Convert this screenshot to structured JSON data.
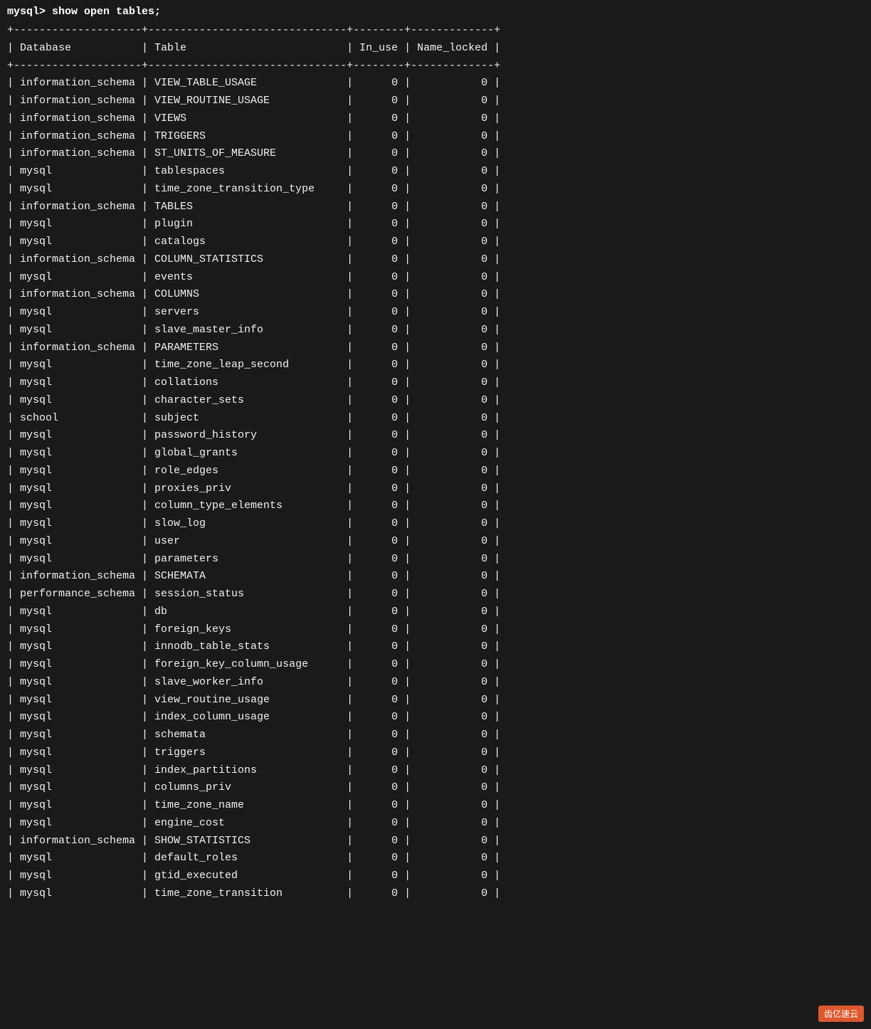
{
  "terminal": {
    "command": "mysql> show open tables;",
    "separator_top": "+--------------------+-------------------------------+--------+-------------+",
    "header": "| Database           | Table                         | In_use | Name_locked |",
    "separator_mid": "+--------------------+-------------------------------+--------+-------------+",
    "rows": [
      {
        "db": "information_schema",
        "table": "VIEW_TABLE_USAGE",
        "inuse": "0",
        "namelocked": "0"
      },
      {
        "db": "information_schema",
        "table": "VIEW_ROUTINE_USAGE",
        "inuse": "0",
        "namelocked": "0"
      },
      {
        "db": "information_schema",
        "table": "VIEWS",
        "inuse": "0",
        "namelocked": "0"
      },
      {
        "db": "information_schema",
        "table": "TRIGGERS",
        "inuse": "0",
        "namelocked": "0"
      },
      {
        "db": "information_schema",
        "table": "ST_UNITS_OF_MEASURE",
        "inuse": "0",
        "namelocked": "0"
      },
      {
        "db": "mysql",
        "table": "tablespaces",
        "inuse": "0",
        "namelocked": "0"
      },
      {
        "db": "mysql",
        "table": "time_zone_transition_type",
        "inuse": "0",
        "namelocked": "0"
      },
      {
        "db": "information_schema",
        "table": "TABLES",
        "inuse": "0",
        "namelocked": "0"
      },
      {
        "db": "mysql",
        "table": "plugin",
        "inuse": "0",
        "namelocked": "0"
      },
      {
        "db": "mysql",
        "table": "catalogs",
        "inuse": "0",
        "namelocked": "0"
      },
      {
        "db": "information_schema",
        "table": "COLUMN_STATISTICS",
        "inuse": "0",
        "namelocked": "0"
      },
      {
        "db": "mysql",
        "table": "events",
        "inuse": "0",
        "namelocked": "0"
      },
      {
        "db": "information_schema",
        "table": "COLUMNS",
        "inuse": "0",
        "namelocked": "0"
      },
      {
        "db": "mysql",
        "table": "servers",
        "inuse": "0",
        "namelocked": "0"
      },
      {
        "db": "mysql",
        "table": "slave_master_info",
        "inuse": "0",
        "namelocked": "0"
      },
      {
        "db": "information_schema",
        "table": "PARAMETERS",
        "inuse": "0",
        "namelocked": "0"
      },
      {
        "db": "mysql",
        "table": "time_zone_leap_second",
        "inuse": "0",
        "namelocked": "0"
      },
      {
        "db": "mysql",
        "table": "collations",
        "inuse": "0",
        "namelocked": "0"
      },
      {
        "db": "mysql",
        "table": "character_sets",
        "inuse": "0",
        "namelocked": "0"
      },
      {
        "db": "school",
        "table": "subject",
        "inuse": "0",
        "namelocked": "0"
      },
      {
        "db": "mysql",
        "table": "password_history",
        "inuse": "0",
        "namelocked": "0"
      },
      {
        "db": "mysql",
        "table": "global_grants",
        "inuse": "0",
        "namelocked": "0"
      },
      {
        "db": "mysql",
        "table": "role_edges",
        "inuse": "0",
        "namelocked": "0"
      },
      {
        "db": "mysql",
        "table": "proxies_priv",
        "inuse": "0",
        "namelocked": "0"
      },
      {
        "db": "mysql",
        "table": "column_type_elements",
        "inuse": "0",
        "namelocked": "0"
      },
      {
        "db": "mysql",
        "table": "slow_log",
        "inuse": "0",
        "namelocked": "0"
      },
      {
        "db": "mysql",
        "table": "user",
        "inuse": "0",
        "namelocked": "0"
      },
      {
        "db": "mysql",
        "table": "parameters",
        "inuse": "0",
        "namelocked": "0"
      },
      {
        "db": "information_schema",
        "table": "SCHEMATA",
        "inuse": "0",
        "namelocked": "0"
      },
      {
        "db": "performance_schema",
        "table": "session_status",
        "inuse": "0",
        "namelocked": "0"
      },
      {
        "db": "mysql",
        "table": "db",
        "inuse": "0",
        "namelocked": "0"
      },
      {
        "db": "mysql",
        "table": "foreign_keys",
        "inuse": "0",
        "namelocked": "0"
      },
      {
        "db": "mysql",
        "table": "innodb_table_stats",
        "inuse": "0",
        "namelocked": "0"
      },
      {
        "db": "mysql",
        "table": "foreign_key_column_usage",
        "inuse": "0",
        "namelocked": "0"
      },
      {
        "db": "mysql",
        "table": "slave_worker_info",
        "inuse": "0",
        "namelocked": "0"
      },
      {
        "db": "mysql",
        "table": "view_routine_usage",
        "inuse": "0",
        "namelocked": "0"
      },
      {
        "db": "mysql",
        "table": "index_column_usage",
        "inuse": "0",
        "namelocked": "0"
      },
      {
        "db": "mysql",
        "table": "schemata",
        "inuse": "0",
        "namelocked": "0"
      },
      {
        "db": "mysql",
        "table": "triggers",
        "inuse": "0",
        "namelocked": "0"
      },
      {
        "db": "mysql",
        "table": "index_partitions",
        "inuse": "0",
        "namelocked": "0"
      },
      {
        "db": "mysql",
        "table": "columns_priv",
        "inuse": "0",
        "namelocked": "0"
      },
      {
        "db": "mysql",
        "table": "time_zone_name",
        "inuse": "0",
        "namelocked": "0"
      },
      {
        "db": "mysql",
        "table": "engine_cost",
        "inuse": "0",
        "namelocked": "0"
      },
      {
        "db": "information_schema",
        "table": "SHOW_STATISTICS",
        "inuse": "0",
        "namelocked": "0"
      },
      {
        "db": "mysql",
        "table": "default_roles",
        "inuse": "0",
        "namelocked": "0"
      },
      {
        "db": "mysql",
        "table": "gtid_executed",
        "inuse": "0",
        "namelocked": "0"
      },
      {
        "db": "mysql",
        "table": "time_zone_transition",
        "inuse": "0",
        "namelocked": "0"
      }
    ],
    "watermark": "齿亿速云"
  }
}
